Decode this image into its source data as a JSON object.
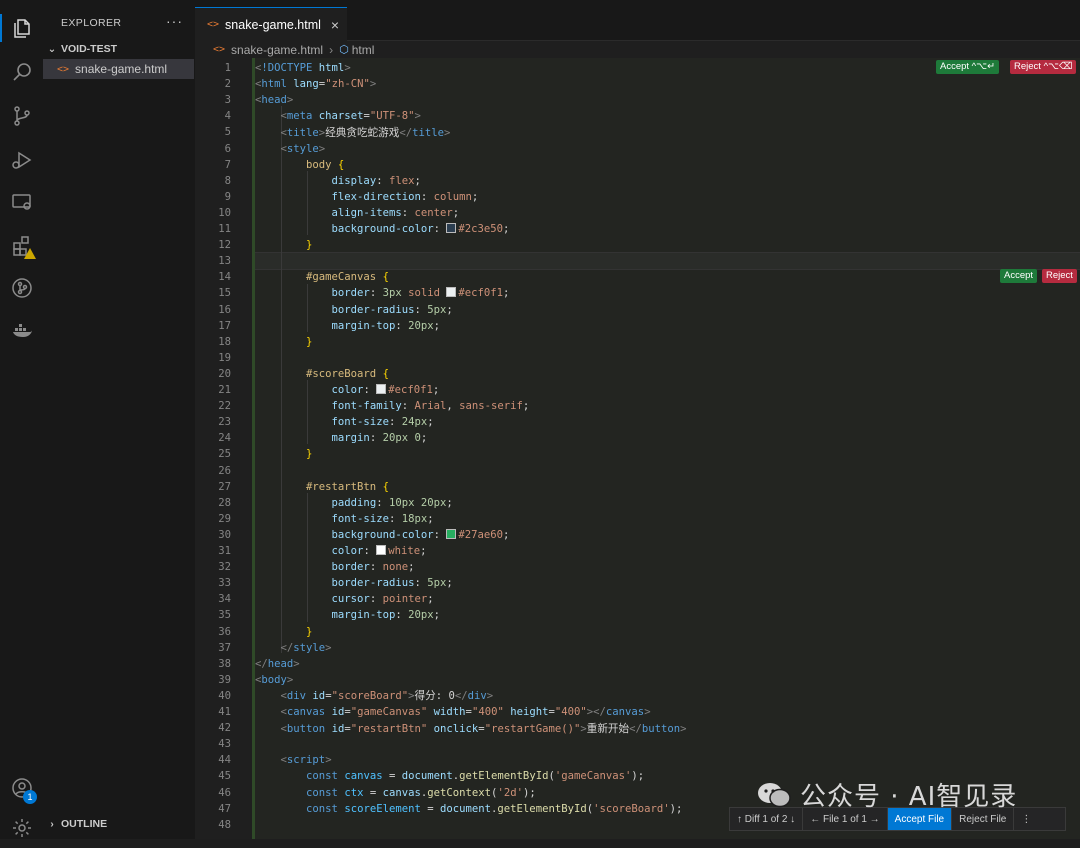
{
  "explorer": {
    "title": "EXPLORER",
    "more": "···",
    "workspace": "VOID-TEST",
    "file": "snake-game.html",
    "outline": "OUTLINE",
    "file_icon": "<>"
  },
  "activity_icons": [
    "files-icon",
    "search-icon",
    "source-control-icon",
    "run-debug-icon",
    "remote-explorer-icon",
    "extensions-icon",
    "git-graph-icon",
    "docker-icon"
  ],
  "account_badge": "1",
  "tab": {
    "label": "snake-game.html",
    "close": "×"
  },
  "breadcrumb": {
    "file": "snake-game.html",
    "symbol": "html",
    "sep": "›"
  },
  "diff_actions": {
    "accept_all": "Accept ^⌥↵",
    "reject_all": "Reject ^⌥⌫",
    "accept": "Accept",
    "reject": "Reject"
  },
  "diff_bar": {
    "diff_nav": "↑ Diff 1 of 2 ↓",
    "file_nav": "← File 1 of 1 →",
    "accept_file": "Accept File",
    "reject_file": "Reject File",
    "more": "⋮"
  },
  "watermark": "公众号 · AI智见录",
  "colors": {
    "accent": "#0078d4",
    "accept": "#1e7a3a",
    "reject": "#b52b3f"
  },
  "code": [
    {
      "n": "1",
      "s": [
        [
          "t-ang",
          "<"
        ],
        [
          "t-tag",
          "!DOCTYPE"
        ],
        [
          "t-attr",
          " html"
        ],
        [
          "t-ang",
          ">"
        ]
      ]
    },
    {
      "n": "2",
      "s": [
        [
          "t-ang",
          "<"
        ],
        [
          "t-tag",
          "html"
        ],
        [
          "t-attr",
          " lang"
        ],
        [
          "t-txt",
          "="
        ],
        [
          "t-str",
          "\"zh-CN\""
        ],
        [
          "t-ang",
          ">"
        ]
      ]
    },
    {
      "n": "3",
      "s": [
        [
          "t-ang",
          "<"
        ],
        [
          "t-tag",
          "head"
        ],
        [
          "t-ang",
          ">"
        ]
      ]
    },
    {
      "n": "4",
      "s": [
        [
          "t-txt",
          "    "
        ],
        [
          "t-ang",
          "<"
        ],
        [
          "t-tag",
          "meta"
        ],
        [
          "t-attr",
          " charset"
        ],
        [
          "t-txt",
          "="
        ],
        [
          "t-str",
          "\"UTF-8\""
        ],
        [
          "t-ang",
          ">"
        ]
      ]
    },
    {
      "n": "5",
      "s": [
        [
          "t-txt",
          "    "
        ],
        [
          "t-ang",
          "<"
        ],
        [
          "t-tag",
          "title"
        ],
        [
          "t-ang",
          ">"
        ],
        [
          "t-txt",
          "经典贪吃蛇游戏"
        ],
        [
          "t-ang",
          "</"
        ],
        [
          "t-tag",
          "title"
        ],
        [
          "t-ang",
          ">"
        ]
      ]
    },
    {
      "n": "6",
      "s": [
        [
          "t-txt",
          "    "
        ],
        [
          "t-ang",
          "<"
        ],
        [
          "t-tag",
          "style"
        ],
        [
          "t-ang",
          ">"
        ]
      ]
    },
    {
      "n": "7",
      "s": [
        [
          "t-txt",
          "        "
        ],
        [
          "t-sel",
          "body"
        ],
        [
          "t-brace",
          " {"
        ]
      ]
    },
    {
      "n": "8",
      "s": [
        [
          "t-txt",
          "            "
        ],
        [
          "t-prop",
          "display"
        ],
        [
          "t-txt",
          ": "
        ],
        [
          "t-val",
          "flex"
        ],
        [
          "t-txt",
          ";"
        ]
      ]
    },
    {
      "n": "9",
      "s": [
        [
          "t-txt",
          "            "
        ],
        [
          "t-prop",
          "flex-direction"
        ],
        [
          "t-txt",
          ": "
        ],
        [
          "t-val",
          "column"
        ],
        [
          "t-txt",
          ";"
        ]
      ]
    },
    {
      "n": "10",
      "s": [
        [
          "t-txt",
          "            "
        ],
        [
          "t-prop",
          "align-items"
        ],
        [
          "t-txt",
          ": "
        ],
        [
          "t-val",
          "center"
        ],
        [
          "t-txt",
          ";"
        ]
      ]
    },
    {
      "n": "11",
      "s": [
        [
          "t-txt",
          "            "
        ],
        [
          "t-prop",
          "background-color"
        ],
        [
          "t-txt",
          ": "
        ],
        [
          "sw sw-a",
          ""
        ],
        [
          "t-val",
          "#2c3e50"
        ],
        [
          "t-txt",
          ";"
        ]
      ]
    },
    {
      "n": "12",
      "s": [
        [
          "t-txt",
          "        "
        ],
        [
          "t-brace",
          "}"
        ]
      ]
    },
    {
      "n": "13",
      "s": []
    },
    {
      "n": "14",
      "s": [
        [
          "t-txt",
          "        "
        ],
        [
          "t-sel",
          "#gameCanvas"
        ],
        [
          "t-brace",
          " {"
        ]
      ]
    },
    {
      "n": "15",
      "s": [
        [
          "t-txt",
          "            "
        ],
        [
          "t-prop",
          "border"
        ],
        [
          "t-txt",
          ": "
        ],
        [
          "t-num",
          "3px"
        ],
        [
          "t-val",
          " solid "
        ],
        [
          "sw sw-b",
          ""
        ],
        [
          "t-val",
          "#ecf0f1"
        ],
        [
          "t-txt",
          ";"
        ]
      ]
    },
    {
      "n": "16",
      "s": [
        [
          "t-txt",
          "            "
        ],
        [
          "t-prop",
          "border-radius"
        ],
        [
          "t-txt",
          ": "
        ],
        [
          "t-num",
          "5px"
        ],
        [
          "t-txt",
          ";"
        ]
      ]
    },
    {
      "n": "17",
      "s": [
        [
          "t-txt",
          "            "
        ],
        [
          "t-prop",
          "margin-top"
        ],
        [
          "t-txt",
          ": "
        ],
        [
          "t-num",
          "20px"
        ],
        [
          "t-txt",
          ";"
        ]
      ]
    },
    {
      "n": "18",
      "s": [
        [
          "t-txt",
          "        "
        ],
        [
          "t-brace",
          "}"
        ]
      ]
    },
    {
      "n": "19",
      "s": []
    },
    {
      "n": "20",
      "s": [
        [
          "t-txt",
          "        "
        ],
        [
          "t-sel",
          "#scoreBoard"
        ],
        [
          "t-brace",
          " {"
        ]
      ]
    },
    {
      "n": "21",
      "s": [
        [
          "t-txt",
          "            "
        ],
        [
          "t-prop",
          "color"
        ],
        [
          "t-txt",
          ": "
        ],
        [
          "sw sw-b",
          ""
        ],
        [
          "t-val",
          "#ecf0f1"
        ],
        [
          "t-txt",
          ";"
        ]
      ]
    },
    {
      "n": "22",
      "s": [
        [
          "t-txt",
          "            "
        ],
        [
          "t-prop",
          "font-family"
        ],
        [
          "t-txt",
          ": "
        ],
        [
          "t-val",
          "Arial"
        ],
        [
          "t-txt",
          ", "
        ],
        [
          "t-val",
          "sans-serif"
        ],
        [
          "t-txt",
          ";"
        ]
      ]
    },
    {
      "n": "23",
      "s": [
        [
          "t-txt",
          "            "
        ],
        [
          "t-prop",
          "font-size"
        ],
        [
          "t-txt",
          ": "
        ],
        [
          "t-num",
          "24px"
        ],
        [
          "t-txt",
          ";"
        ]
      ]
    },
    {
      "n": "24",
      "s": [
        [
          "t-txt",
          "            "
        ],
        [
          "t-prop",
          "margin"
        ],
        [
          "t-txt",
          ": "
        ],
        [
          "t-num",
          "20px 0"
        ],
        [
          "t-txt",
          ";"
        ]
      ]
    },
    {
      "n": "25",
      "s": [
        [
          "t-txt",
          "        "
        ],
        [
          "t-brace",
          "}"
        ]
      ]
    },
    {
      "n": "26",
      "s": []
    },
    {
      "n": "27",
      "s": [
        [
          "t-txt",
          "        "
        ],
        [
          "t-sel",
          "#restartBtn"
        ],
        [
          "t-brace",
          " {"
        ]
      ]
    },
    {
      "n": "28",
      "s": [
        [
          "t-txt",
          "            "
        ],
        [
          "t-prop",
          "padding"
        ],
        [
          "t-txt",
          ": "
        ],
        [
          "t-num",
          "10px 20px"
        ],
        [
          "t-txt",
          ";"
        ]
      ]
    },
    {
      "n": "29",
      "s": [
        [
          "t-txt",
          "            "
        ],
        [
          "t-prop",
          "font-size"
        ],
        [
          "t-txt",
          ": "
        ],
        [
          "t-num",
          "18px"
        ],
        [
          "t-txt",
          ";"
        ]
      ]
    },
    {
      "n": "30",
      "s": [
        [
          "t-txt",
          "            "
        ],
        [
          "t-prop",
          "background-color"
        ],
        [
          "t-txt",
          ": "
        ],
        [
          "sw sw-c",
          ""
        ],
        [
          "t-val",
          "#27ae60"
        ],
        [
          "t-txt",
          ";"
        ]
      ]
    },
    {
      "n": "31",
      "s": [
        [
          "t-txt",
          "            "
        ],
        [
          "t-prop",
          "color"
        ],
        [
          "t-txt",
          ": "
        ],
        [
          "sw sw-d",
          ""
        ],
        [
          "t-val",
          "white"
        ],
        [
          "t-txt",
          ";"
        ]
      ]
    },
    {
      "n": "32",
      "s": [
        [
          "t-txt",
          "            "
        ],
        [
          "t-prop",
          "border"
        ],
        [
          "t-txt",
          ": "
        ],
        [
          "t-val",
          "none"
        ],
        [
          "t-txt",
          ";"
        ]
      ]
    },
    {
      "n": "33",
      "s": [
        [
          "t-txt",
          "            "
        ],
        [
          "t-prop",
          "border-radius"
        ],
        [
          "t-txt",
          ": "
        ],
        [
          "t-num",
          "5px"
        ],
        [
          "t-txt",
          ";"
        ]
      ]
    },
    {
      "n": "34",
      "s": [
        [
          "t-txt",
          "            "
        ],
        [
          "t-prop",
          "cursor"
        ],
        [
          "t-txt",
          ": "
        ],
        [
          "t-val",
          "pointer"
        ],
        [
          "t-txt",
          ";"
        ]
      ]
    },
    {
      "n": "35",
      "s": [
        [
          "t-txt",
          "            "
        ],
        [
          "t-prop",
          "margin-top"
        ],
        [
          "t-txt",
          ": "
        ],
        [
          "t-num",
          "20px"
        ],
        [
          "t-txt",
          ";"
        ]
      ]
    },
    {
      "n": "36",
      "s": [
        [
          "t-txt",
          "        "
        ],
        [
          "t-brace",
          "}"
        ]
      ]
    },
    {
      "n": "37",
      "s": [
        [
          "t-txt",
          "    "
        ],
        [
          "t-ang",
          "</"
        ],
        [
          "t-tag",
          "style"
        ],
        [
          "t-ang",
          ">"
        ]
      ]
    },
    {
      "n": "38",
      "s": [
        [
          "t-ang",
          "</"
        ],
        [
          "t-tag",
          "head"
        ],
        [
          "t-ang",
          ">"
        ]
      ]
    },
    {
      "n": "39",
      "s": [
        [
          "t-ang",
          "<"
        ],
        [
          "t-tag",
          "body"
        ],
        [
          "t-ang",
          ">"
        ]
      ]
    },
    {
      "n": "40",
      "s": [
        [
          "t-txt",
          "    "
        ],
        [
          "t-ang",
          "<"
        ],
        [
          "t-tag",
          "div"
        ],
        [
          "t-attr",
          " id"
        ],
        [
          "t-txt",
          "="
        ],
        [
          "t-str",
          "\"scoreBoard\""
        ],
        [
          "t-ang",
          ">"
        ],
        [
          "t-txt",
          "得分: 0"
        ],
        [
          "t-ang",
          "</"
        ],
        [
          "t-tag",
          "div"
        ],
        [
          "t-ang",
          ">"
        ]
      ]
    },
    {
      "n": "41",
      "s": [
        [
          "t-txt",
          "    "
        ],
        [
          "t-ang",
          "<"
        ],
        [
          "t-tag",
          "canvas"
        ],
        [
          "t-attr",
          " id"
        ],
        [
          "t-txt",
          "="
        ],
        [
          "t-str",
          "\"gameCanvas\""
        ],
        [
          "t-attr",
          " width"
        ],
        [
          "t-txt",
          "="
        ],
        [
          "t-str",
          "\"400\""
        ],
        [
          "t-attr",
          " height"
        ],
        [
          "t-txt",
          "="
        ],
        [
          "t-str",
          "\"400\""
        ],
        [
          "t-ang",
          "></"
        ],
        [
          "t-tag",
          "canvas"
        ],
        [
          "t-ang",
          ">"
        ]
      ]
    },
    {
      "n": "42",
      "s": [
        [
          "t-txt",
          "    "
        ],
        [
          "t-ang",
          "<"
        ],
        [
          "t-tag",
          "button"
        ],
        [
          "t-attr",
          " id"
        ],
        [
          "t-txt",
          "="
        ],
        [
          "t-str",
          "\"restartBtn\""
        ],
        [
          "t-attr",
          " onclick"
        ],
        [
          "t-txt",
          "="
        ],
        [
          "t-str",
          "\"restartGame()\""
        ],
        [
          "t-ang",
          ">"
        ],
        [
          "t-txt",
          "重新开始"
        ],
        [
          "t-ang",
          "</"
        ],
        [
          "t-tag",
          "button"
        ],
        [
          "t-ang",
          ">"
        ]
      ]
    },
    {
      "n": "43",
      "s": []
    },
    {
      "n": "44",
      "s": [
        [
          "t-txt",
          "    "
        ],
        [
          "t-ang",
          "<"
        ],
        [
          "t-tag",
          "script"
        ],
        [
          "t-ang",
          ">"
        ]
      ]
    },
    {
      "n": "45",
      "s": [
        [
          "t-txt",
          "        "
        ],
        [
          "t-kw",
          "const "
        ],
        [
          "t-var",
          "canvas"
        ],
        [
          "t-txt",
          " = "
        ],
        [
          "t-attr",
          "document"
        ],
        [
          "t-txt",
          "."
        ],
        [
          "t-fn",
          "getElementById"
        ],
        [
          "t-txt",
          "("
        ],
        [
          "t-str",
          "'gameCanvas'"
        ],
        [
          "t-txt",
          ");"
        ]
      ]
    },
    {
      "n": "46",
      "s": [
        [
          "t-txt",
          "        "
        ],
        [
          "t-kw",
          "const "
        ],
        [
          "t-var",
          "ctx"
        ],
        [
          "t-txt",
          " = "
        ],
        [
          "t-attr",
          "canvas"
        ],
        [
          "t-txt",
          "."
        ],
        [
          "t-fn",
          "getContext"
        ],
        [
          "t-txt",
          "("
        ],
        [
          "t-str",
          "'2d'"
        ],
        [
          "t-txt",
          ");"
        ]
      ]
    },
    {
      "n": "47",
      "s": [
        [
          "t-txt",
          "        "
        ],
        [
          "t-kw",
          "const "
        ],
        [
          "t-var",
          "scoreElement"
        ],
        [
          "t-txt",
          " = "
        ],
        [
          "t-attr",
          "document"
        ],
        [
          "t-txt",
          "."
        ],
        [
          "t-fn",
          "getElementById"
        ],
        [
          "t-txt",
          "("
        ],
        [
          "t-str",
          "'scoreBoard'"
        ],
        [
          "t-txt",
          ");"
        ]
      ]
    },
    {
      "n": "48",
      "s": []
    }
  ]
}
